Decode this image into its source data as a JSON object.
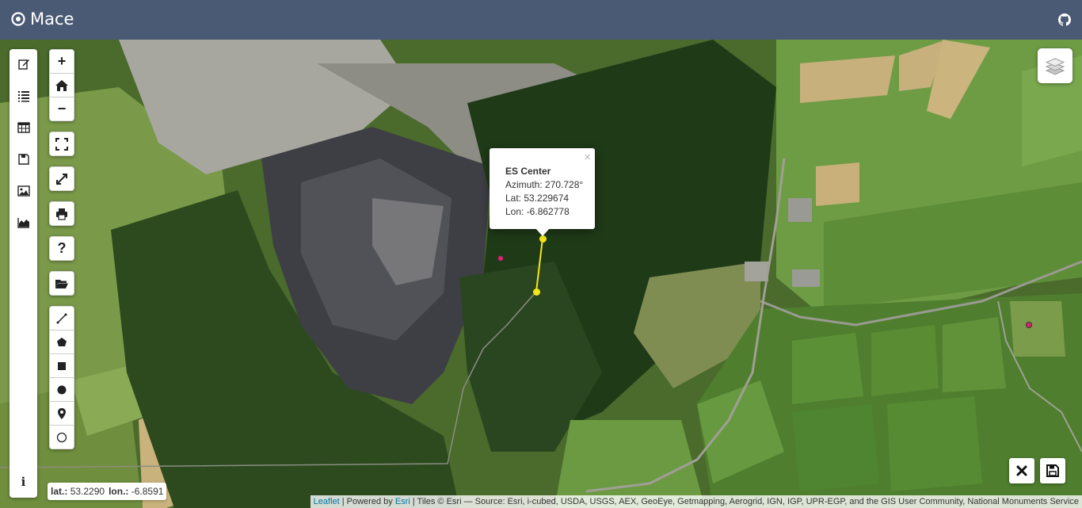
{
  "navbar": {
    "title": "Mace",
    "github_icon": "github-icon"
  },
  "sidebar": {
    "items": [
      {
        "name": "edit-icon"
      },
      {
        "name": "list-icon"
      },
      {
        "name": "table-icon"
      },
      {
        "name": "save-icon"
      },
      {
        "name": "image-icon"
      },
      {
        "name": "area-chart-icon"
      }
    ],
    "info_label": "i"
  },
  "controls": {
    "zoom_in": "+",
    "home_icon": "home-icon",
    "zoom_out": "−",
    "help": "?"
  },
  "popup": {
    "close": "×",
    "title": "ES Center",
    "azimuth": "Azimuth: 270.728°",
    "lat": "Lat: 53.229674",
    "lon": "Lon: -6.862778"
  },
  "coords": {
    "lat_label": "lat.:",
    "lat_value": "53.2290",
    "lon_label": "lon.:",
    "lon_value": "-6.8591"
  },
  "attribution": {
    "leaflet": "Leaflet",
    "sep1": " | Powered by ",
    "esri": "Esri",
    "tiles": " | Tiles © Esri — Source: Esri, i-cubed, USDA, USGS, AEX, GeoEye, Getmapping, Aerogrid, IGN, IGP, UPR-EGP, and the GIS User Community, National Monuments Service"
  },
  "colors": {
    "navbar": "#4b5a74",
    "marker_yellow": "#f5e61a",
    "marker_pink": "#e0216f"
  }
}
